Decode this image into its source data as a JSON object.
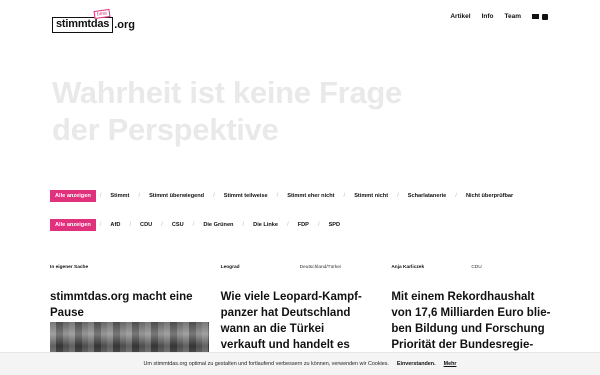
{
  "header": {
    "logo_text": "stimmtdas",
    "logo_tld": ".org",
    "logo_badge": "beta",
    "nav": [
      "Artikel",
      "Info",
      "Team"
    ],
    "icons": [
      "mail-icon",
      "rss-icon"
    ]
  },
  "hero": {
    "line1": "Wahrheit ist keine Frage",
    "line2": "der Perspektive"
  },
  "filters": {
    "verdicts": [
      "Alle anzeigen",
      "Stimmt",
      "Stimmt überwiegend",
      "Stimmt teilweise",
      "Stimmt eher nicht",
      "Stimmt nicht",
      "Scharlatanerie",
      "Nicht überprüfbar"
    ],
    "parties": [
      "Alle anzeigen",
      "AfD",
      "CDU",
      "CSU",
      "Die Grünen",
      "Die Linke",
      "FDP",
      "SPD"
    ]
  },
  "articles": [
    {
      "author": "In eigener Sache",
      "tag": "",
      "title": "stimmtdas.org macht eine Pause"
    },
    {
      "author": "Leograd",
      "tag": "Deutschland/Türkei",
      "title": "Wie viele Leopard-Kampf-panzer hat Deutschland wann an die Türkei verkauft und handelt es sich dabei um"
    },
    {
      "author": "Anja Karliczek",
      "tag": "CDU",
      "title": "Mit einem Rekordhaushalt von 17,6 Milliarden Euro blie-ben Bildung und Forschung Priorität der Bundesregie-"
    }
  ],
  "cookie": {
    "text": "Um stimmtdas.org optimal zu gestalten und fortlaufend verbessern zu können, verwenden wir Cookies.",
    "accept": "Einverstanden.",
    "more": "Mehr"
  },
  "colors": {
    "accent": "#e0317c",
    "hero_text": "#e9e9e9"
  }
}
